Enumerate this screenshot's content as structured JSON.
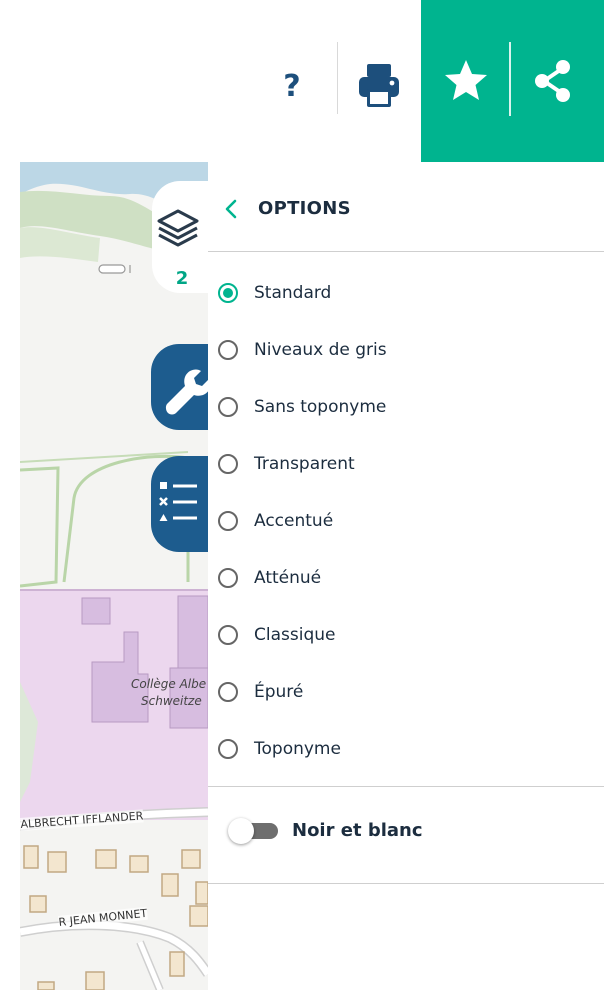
{
  "toolbar": {
    "help_label": "?",
    "print_icon": "print-icon",
    "favorite_icon": "star-icon",
    "share_icon": "share-icon",
    "accent_color": "#00b48f"
  },
  "map": {
    "layers_icon": "layers-icon",
    "layers_count": "2",
    "tools_icon": "wrench-icon",
    "legend_icon": "legend-list-icon",
    "labels": {
      "college_line1": "Collège Albe",
      "college_line2": "Schweitze",
      "road_albrecht": "ALBRECHT IFFLANDER",
      "road_jean": "R JEAN MONNET"
    },
    "button_color": "#1d5c8e"
  },
  "panel": {
    "title": "OPTIONS",
    "back_icon": "chevron-left-icon",
    "options": [
      {
        "label": "Standard",
        "selected": true
      },
      {
        "label": "Niveaux de gris",
        "selected": false
      },
      {
        "label": "Sans toponyme",
        "selected": false
      },
      {
        "label": "Transparent",
        "selected": false
      },
      {
        "label": "Accentué",
        "selected": false
      },
      {
        "label": "Atténué",
        "selected": false
      },
      {
        "label": "Classique",
        "selected": false
      },
      {
        "label": "Épuré",
        "selected": false
      },
      {
        "label": "Toponyme",
        "selected": false
      }
    ],
    "toggle": {
      "label": "Noir et blanc",
      "on": false
    }
  }
}
